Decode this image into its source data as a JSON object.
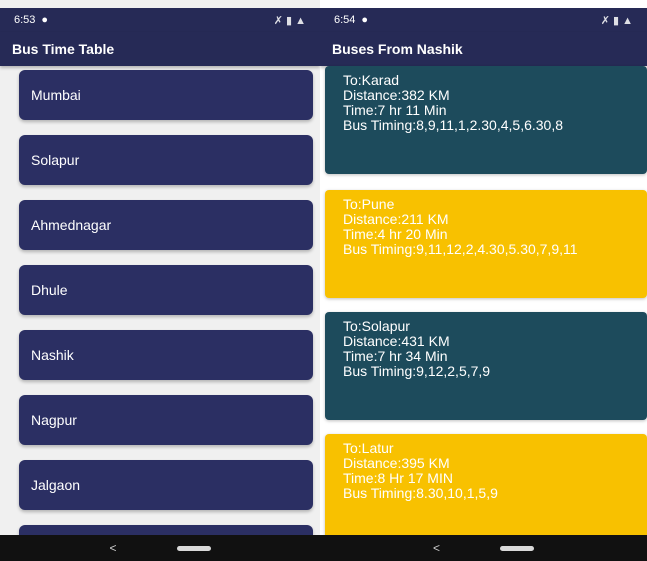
{
  "left": {
    "status": {
      "time": "6:53",
      "icons": "✗ ▮ ▲"
    },
    "title": "Bus Time Table",
    "cities": [
      "Mumbai",
      "Solapur",
      "Ahmednagar",
      "Dhule",
      "Nashik",
      "Nagpur",
      "Jalgaon",
      ""
    ]
  },
  "right": {
    "status": {
      "time": "6:54",
      "icons": "✗ ▮ ▲"
    },
    "title": "Buses From Nashik",
    "routes": [
      {
        "color": "teal",
        "to": "To:Karad",
        "distance": "Distance:382 KM",
        "time": "Time:7 hr 11 Min",
        "timing": "Bus Timing:8,9,11,1,2.30,4,5,6.30,8"
      },
      {
        "color": "yellow",
        "to": "To:Pune",
        "distance": "Distance:211 KM",
        "time": "Time:4 hr 20 Min",
        "timing": "Bus Timing:9,11,12,2,4.30,5.30,7,9,11"
      },
      {
        "color": "teal",
        "to": "To:Solapur",
        "distance": "Distance:431 KM",
        "time": "Time:7 hr 34 Min",
        "timing": "Bus Timing:9,12,2,5,7,9"
      },
      {
        "color": "yellow",
        "to": "To:Latur",
        "distance": "Distance:395 KM",
        "time": "Time:8 Hr 17 MIN",
        "timing": "Bus Timing:8.30,10,1,5,9"
      }
    ]
  },
  "nav": {
    "back": "<"
  },
  "colors": {
    "appbar": "#262a56",
    "city_button": "#2b2f63",
    "teal_card": "#1d4b5c",
    "yellow_card": "#f8c100"
  }
}
